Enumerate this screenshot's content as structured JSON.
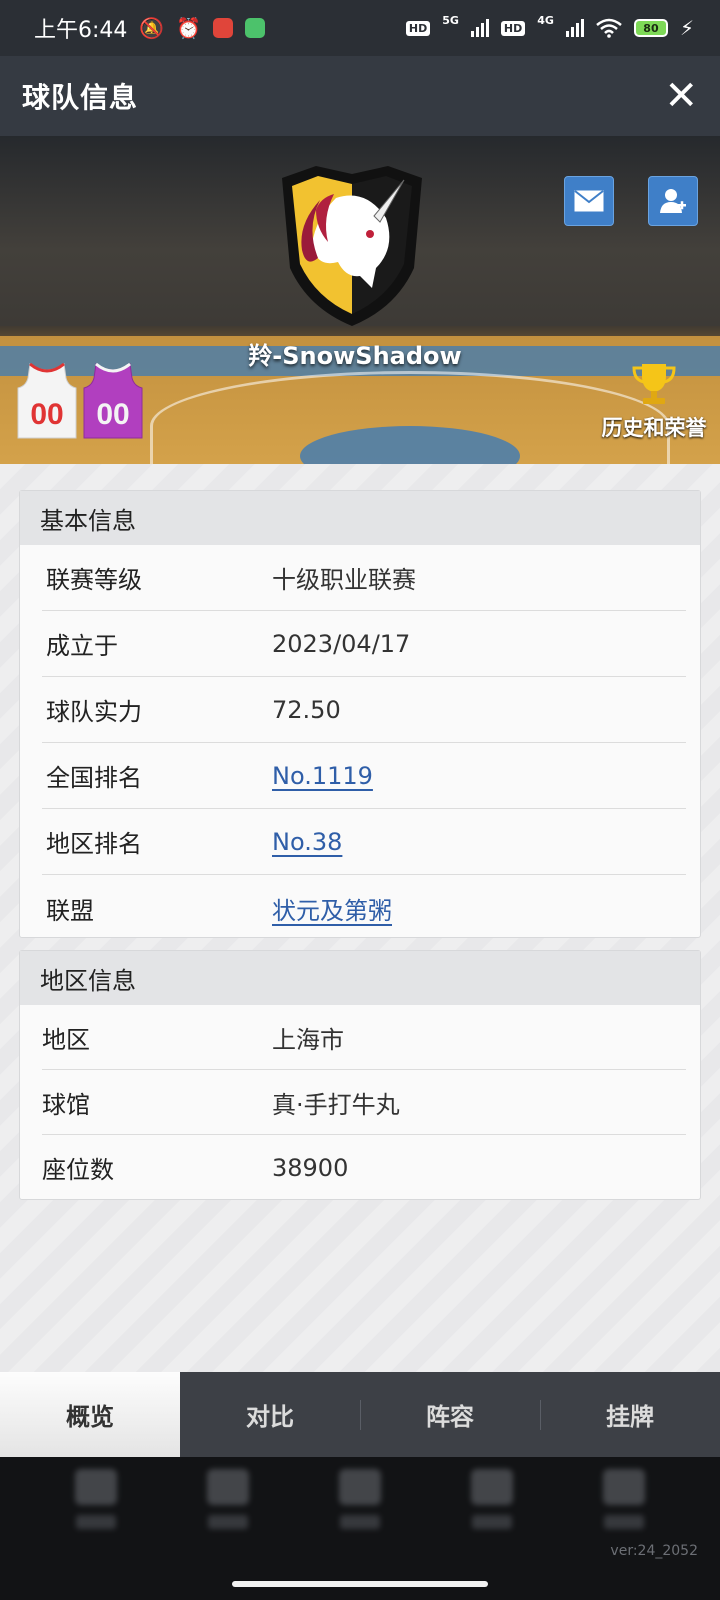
{
  "status_bar": {
    "time": "上午6:44",
    "net1": "5G",
    "net2": "4G",
    "hd": "HD",
    "battery": "80"
  },
  "header": {
    "title": "球队信息",
    "close_icon": "✕"
  },
  "banner": {
    "team_name": "羚-SnowShadow",
    "jersey_number": "00",
    "honor_label": "历史和荣誉",
    "colors": {
      "home_jersey": "#e03434",
      "away_jersey": "#b13fbf"
    }
  },
  "basic_info": {
    "title": "基本信息",
    "rows": [
      {
        "label": "联赛等级",
        "value": "十级职业联赛"
      },
      {
        "label": "成立于",
        "value": "2023/04/17"
      },
      {
        "label": "球队实力",
        "value": "72.50"
      },
      {
        "label": "全国排名",
        "value": "No.1119"
      },
      {
        "label": "地区排名",
        "value": "No.38"
      },
      {
        "label": "联盟",
        "value": "状元及第粥"
      }
    ]
  },
  "region_info": {
    "title": "地区信息",
    "rows": [
      {
        "label": "地区",
        "value": "上海市"
      },
      {
        "label": "球馆",
        "value": "真·手打牛丸"
      },
      {
        "label": "座位数",
        "value": "38900"
      }
    ]
  },
  "tabs": [
    {
      "label": "概览"
    },
    {
      "label": "对比"
    },
    {
      "label": "阵容"
    },
    {
      "label": "挂牌"
    }
  ],
  "footer": {
    "version": "ver:24_2052"
  }
}
